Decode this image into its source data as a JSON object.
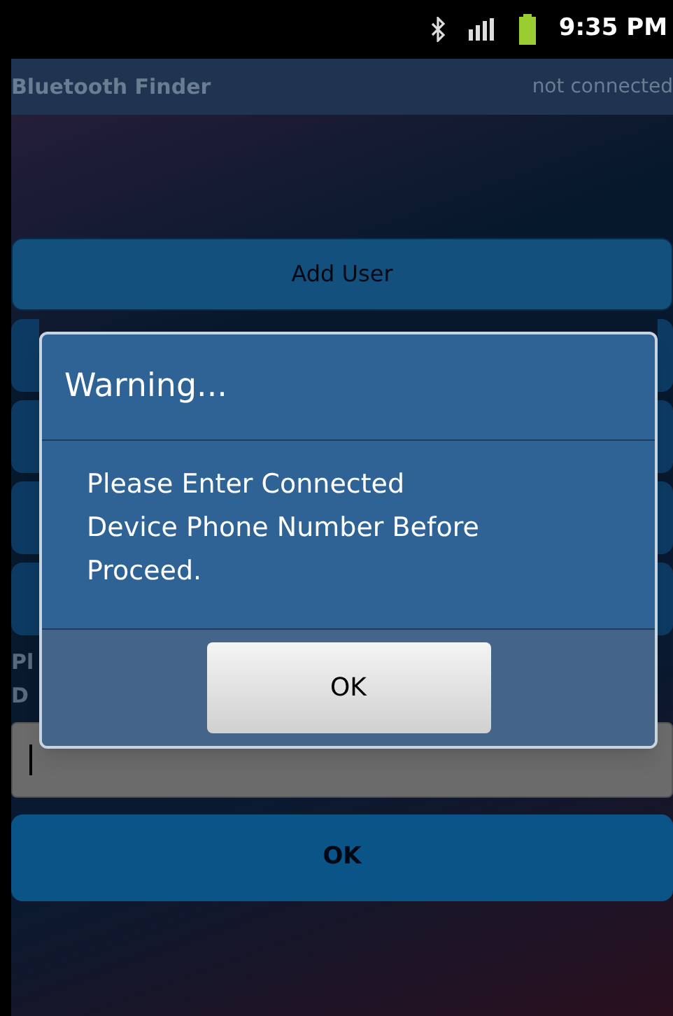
{
  "status_bar": {
    "time": "9:35 PM"
  },
  "app_bar": {
    "title": "Bluetooth Finder",
    "status": "not connected"
  },
  "buttons": [
    {
      "label": "Add User"
    }
  ],
  "form": {
    "label_1": "Pl",
    "label_2": "D",
    "submit": "OK"
  },
  "dialog": {
    "title": "Warning...",
    "message": "Please Enter Connected Device Phone Number Before Proceed.",
    "button": "OK"
  }
}
